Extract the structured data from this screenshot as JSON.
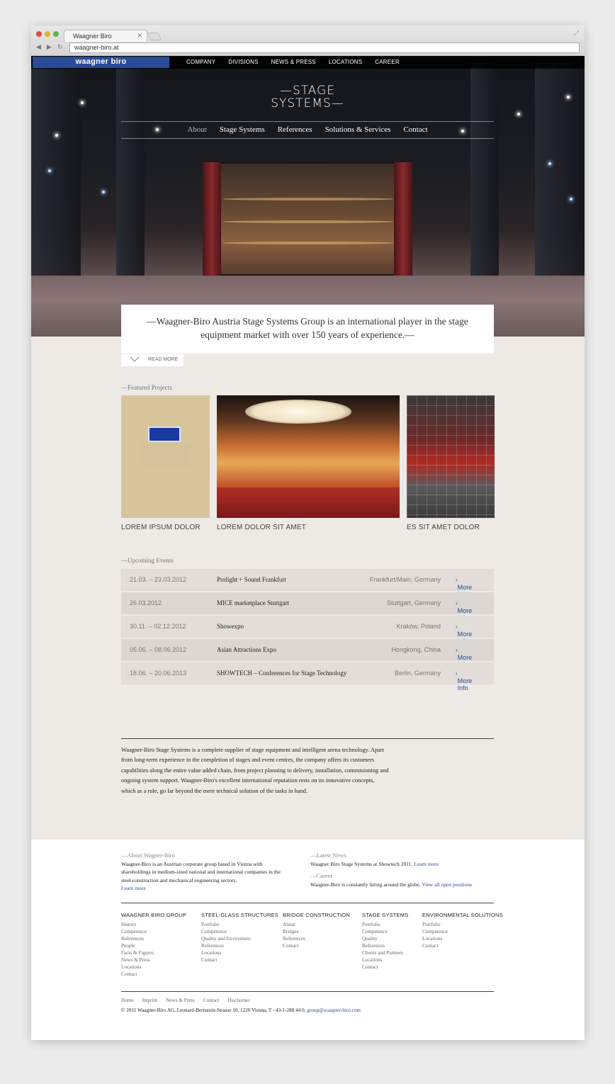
{
  "browser": {
    "tab_title": "Waagner Biro",
    "url": "waagner-biro.at"
  },
  "topbar": {
    "logo": "waagner biro",
    "nav": [
      "COMPANY",
      "DIVISIONS",
      "NEWS & PRESS",
      "LOCATIONS",
      "CAREER"
    ]
  },
  "hero": {
    "brand_line1": "—STAGE",
    "brand_line2": "SYSTEMS—",
    "subnav": [
      "About",
      "Stage Systems",
      "References",
      "Solutions & Services",
      "Contact"
    ],
    "intro": "—Waagner-Biro Austria Stage Systems Group is an international player in the stage equipment market with over 150 years of experience.—",
    "read_more": "READ MORE"
  },
  "featured": {
    "label": "—Featured Projects",
    "projects": [
      {
        "caption": "LOREM IPSUM DOLOR"
      },
      {
        "caption": "LOREM DOLOR SIT AMET"
      },
      {
        "caption": "ES SIT AMET DOLOR"
      }
    ]
  },
  "events": {
    "label": "—Upcoming Events",
    "more_label": "More Info",
    "rows": [
      {
        "date": "21.03. – 23.03.2012",
        "name": "Prolight + Sound Frankfurt",
        "location": "Frankfurt/Main, Germany"
      },
      {
        "date": "26.03.2012",
        "name": "MICE marketplace Stuttgart",
        "location": "Stuttgart, Germany"
      },
      {
        "date": "30.11. – 02.12.2012",
        "name": "Showexpo",
        "location": "Kraków, Poland"
      },
      {
        "date": "05.06. – 08.06.2012",
        "name": "Asian Attractions Expo",
        "location": "Hongkong, China"
      },
      {
        "date": "18.06. – 20.06.2013",
        "name": "SHOWTECH – Conferences for Stage Technology",
        "location": "Berlin, Germany"
      }
    ]
  },
  "about_text": "Waagner-Biro Stage Systems is a complete supplier of stage equipment and intelligent arena technology. Apart from long-term experience in the completion of stages and event centres, the company offers its customers capabilities along the entire value added chain, from project planning to delivery, installation, commisioning and ongoing system support. Waagner-Biro's excellent international reputation rests on its innovative concepts, which as a rule, go far beyond the mere technical solution of the tasks in hand.",
  "footer": {
    "about_label": "—About Wagner-Biro",
    "about_text": "Waagner-Biro is an Austrian corporate group based in Vienna with shareholdings in medium-sized national and international companies in the steel construction and mechanical engineering sectors.",
    "about_link": "Learn more",
    "news_label": "—Latest News",
    "news_text": "Waagner Biro Stage Systems at Showtech 2011.",
    "news_link": "Learn more",
    "career_label": "—Career",
    "career_text": "Waagner-Biro is constantly hiring around the globe.",
    "career_link": "View all open positions",
    "columns": [
      {
        "heading": "WAAGNER BIRO GROUP",
        "items": [
          "History",
          "Competence",
          "References",
          "People",
          "Facts & Figures",
          "News & Press",
          "Locations",
          "Contact"
        ]
      },
      {
        "heading": "STEEL-GLASS STRUCTURES",
        "items": [
          "Portfolio",
          "Competence",
          "Quality and Enviroment",
          "References",
          "Locations",
          "Contact"
        ]
      },
      {
        "heading": "BRIDGE CONSTRUCTION",
        "items": [
          "About",
          "Bridges",
          "References",
          "Contact"
        ]
      },
      {
        "heading": "STAGE SYSTEMS",
        "items": [
          "Portfolio",
          "Competence",
          "Quality",
          "References",
          "Clients and Partners",
          "Locations",
          "Contact"
        ]
      },
      {
        "heading": "ENVIRONMENTAL  SOLUTIONS",
        "items": [
          "Portfolio",
          "Competence",
          "Locations",
          "Contact"
        ]
      }
    ],
    "bottom_links": [
      "Home",
      "Imprint",
      "News & Press",
      "Contact",
      "Disclaimer"
    ],
    "copyright": "© 2011 Waagner-Biro AG, Leonard-Bernstein-Strasse 10, 1220 Vienna, T +43-1-288 44 0,",
    "email": "group@waagner-biro.com"
  }
}
